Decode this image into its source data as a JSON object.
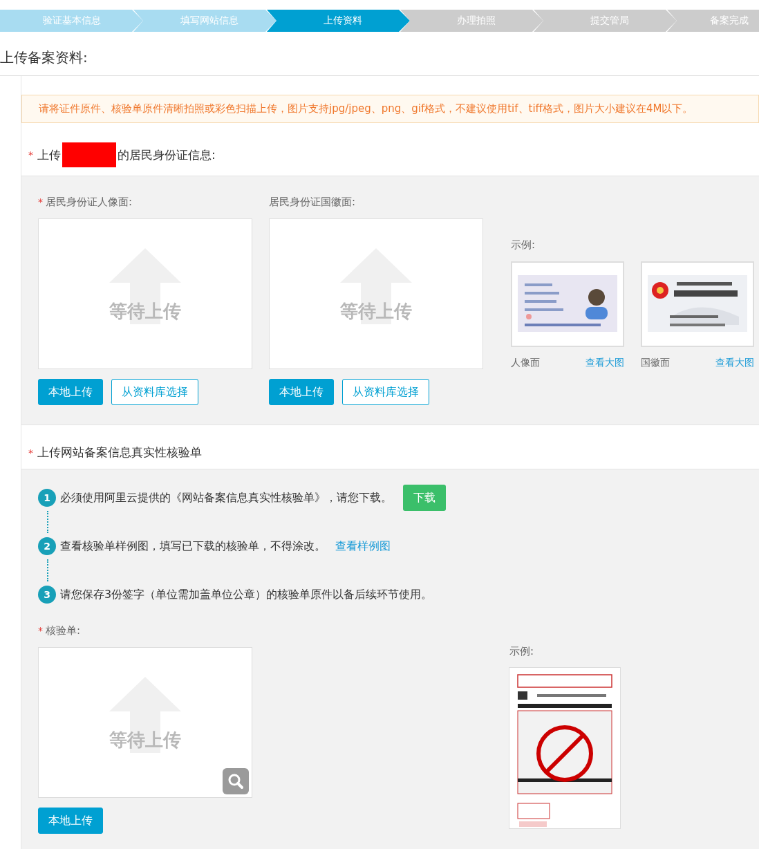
{
  "steps": [
    {
      "label": "验证基本信息",
      "completed": true,
      "selected": false
    },
    {
      "label": "填写网站信息",
      "completed": true,
      "selected": false
    },
    {
      "label": "上传资料",
      "completed": false,
      "selected": true
    },
    {
      "label": "办理拍照",
      "completed": false,
      "selected": false
    },
    {
      "label": "提交管局",
      "completed": false,
      "selected": false
    },
    {
      "label": "备案完成",
      "completed": false,
      "selected": false
    }
  ],
  "page_title": "上传备案资料:",
  "notice": "请将证件原件、核验单原件清晰拍照或彩色扫描上传，图片支持jpg/jpeg、png、gif格式，不建议使用tif、tiff格式，图片大小建议在4M以下。",
  "id_section": {
    "mark": "*",
    "title_prefix": "上传",
    "redacted": true,
    "title_suffix": "的居民身份证信息:",
    "uploads": [
      {
        "mark": "*",
        "label": "居民身份证人像面:",
        "placeholder": "等待上传",
        "buttons": [
          {
            "label": "本地上传",
            "kind": "primary"
          },
          {
            "label": "从资料库选择",
            "kind": "outline"
          }
        ]
      },
      {
        "label": "居民身份证国徽面:",
        "placeholder": "等待上传",
        "buttons": [
          {
            "label": "本地上传",
            "kind": "primary"
          },
          {
            "label": "从资料库选择",
            "kind": "outline"
          }
        ]
      }
    ],
    "example_label": "示例:",
    "examples": [
      {
        "kind": "id-front",
        "caption": "人像面",
        "link": "查看大图"
      },
      {
        "kind": "id-back",
        "caption": "国徽面",
        "link": "查看大图"
      }
    ]
  },
  "verify_section": {
    "mark": "*",
    "title": "上传网站备案信息真实性核验单",
    "steps": [
      {
        "number": "1",
        "text": "必须使用阿里云提供的《网站备案信息真实性核验单》，请您下载。",
        "action": {
          "kind": "button",
          "label": "下载"
        }
      },
      {
        "number": "2",
        "text": "查看核验单样例图，填写已下载的核验单，不得涂改。",
        "action": {
          "kind": "link",
          "label": "查看样例图"
        }
      },
      {
        "number": "3",
        "text": "请您保存3份签字（单位需加盖单位公章）的核验单原件以备后续环节使用。"
      }
    ],
    "upload": {
      "mark": "*",
      "label": "核验单:",
      "placeholder": "等待上传",
      "zoom": true,
      "buttons": [
        {
          "label": "本地上传",
          "kind": "primary"
        }
      ]
    },
    "example_label": "示例:",
    "example": {
      "kind": "form"
    }
  }
}
